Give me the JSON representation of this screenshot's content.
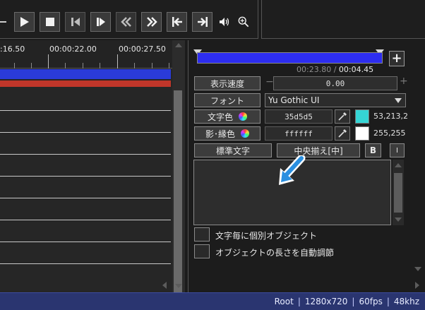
{
  "toolbar": {
    "buttons": [
      {
        "name": "play-button",
        "icon": "play-icon"
      },
      {
        "name": "stop-button",
        "icon": "stop-icon"
      },
      {
        "name": "prev-frame-button",
        "icon": "step-back-icon"
      },
      {
        "name": "next-frame-button",
        "icon": "step-forward-icon"
      },
      {
        "name": "rewind-button",
        "icon": "double-left-icon"
      },
      {
        "name": "fast-forward-button",
        "icon": "double-right-icon"
      },
      {
        "name": "go-start-button",
        "icon": "skip-start-icon"
      },
      {
        "name": "go-end-button",
        "icon": "skip-end-icon"
      }
    ],
    "volume_icon": "volume-icon",
    "zoom_icon": "zoom-in-icon"
  },
  "timeline": {
    "tick_labels": [
      ":16.50",
      "00:00:22.00",
      "00:00:27.50"
    ],
    "track_colors": {
      "blue": "#2a3bd9",
      "red": "#c0362a"
    }
  },
  "properties": {
    "time_current": "00:23.80",
    "time_separator": " / ",
    "time_total": "00:04.45",
    "plus_label": "+",
    "speed_label": "表示速度",
    "speed_value": "0.00",
    "speed_minus": "−",
    "speed_plus": "+",
    "font_label": "フォント",
    "font_value": "Yu Gothic UI",
    "text_color_label": "文字色",
    "text_color_value": "35d5d5",
    "text_color_hex": "#35d5d5",
    "text_color_rgb": "53,213,2",
    "shadow_color_label": "影･縁色",
    "shadow_color_value": "ffffff",
    "shadow_color_hex": "#ffffff",
    "shadow_color_rgb": "255,255",
    "style_label": "標準文字",
    "align_label": "中央揃え[中]",
    "bold_label": "B",
    "italic_label": "I",
    "text_content": "",
    "checkbox_individual_label": "文字毎に個別オブジェクト",
    "checkbox_autolength_label": "オブジェクトの長さを自動調節"
  },
  "status": {
    "root": "Root",
    "resolution": "1280x720",
    "fps": "60fps",
    "sample_rate": "48khz"
  }
}
